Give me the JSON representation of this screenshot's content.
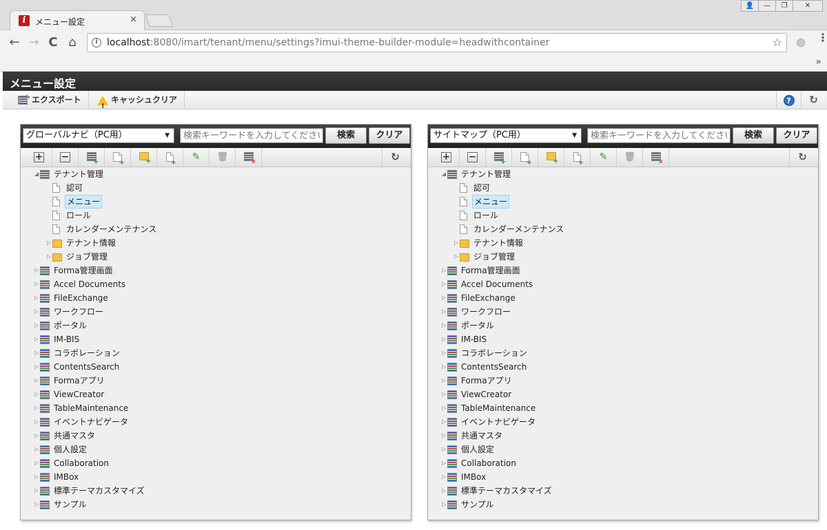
{
  "browser": {
    "tab_title": "メニュー設定",
    "favicon_letter": "i",
    "tab_close": "×",
    "url_host": "localhost",
    "url_rest": ":8080/imart/tenant/menu/settings?imui-theme-builder-module=headwithcontainer",
    "back": "←",
    "forward": "→",
    "reload": "C",
    "home": "⌂",
    "star": "☆",
    "win_user": "👤",
    "win_min": "—",
    "win_max": "❐",
    "win_close": "✕",
    "bookmarks_more": "»",
    "menu_dots": "⋮"
  },
  "page": {
    "title": "メニュー設定",
    "toolbar": {
      "export_label": "エクスポート",
      "cache_clear_label": "キャッシュクリア",
      "help_glyph": "?",
      "refresh_glyph": "↻"
    }
  },
  "panels": [
    {
      "select_value": "グローバルナビ（PC用）",
      "search_placeholder": "検索キーワードを入力してください。",
      "search_label": "検索",
      "clear_label": "クリア",
      "tree": [
        {
          "label": "テナント管理",
          "type": "menu",
          "level": 0,
          "toggle": "◢"
        },
        {
          "label": "認可",
          "type": "page",
          "level": 1,
          "toggle": ""
        },
        {
          "label": "メニュー",
          "type": "page",
          "level": 1,
          "toggle": "",
          "selected": true
        },
        {
          "label": "ロール",
          "type": "page",
          "level": 1,
          "toggle": ""
        },
        {
          "label": "カレンダーメンテナンス",
          "type": "page",
          "level": 1,
          "toggle": ""
        },
        {
          "label": "テナント情報",
          "type": "folder",
          "level": 1,
          "toggle": "▷"
        },
        {
          "label": "ジョブ管理",
          "type": "folder",
          "level": 1,
          "toggle": "▷"
        },
        {
          "label": "Forma管理画面",
          "type": "menu",
          "level": 0,
          "toggle": "▷"
        },
        {
          "label": "Accel Documents",
          "type": "menu",
          "level": 0,
          "toggle": "▷"
        },
        {
          "label": "FileExchange",
          "type": "menu",
          "level": 0,
          "toggle": "▷"
        },
        {
          "label": "ワークフロー",
          "type": "menu",
          "level": 0,
          "toggle": "▷"
        },
        {
          "label": "ポータル",
          "type": "menu",
          "level": 0,
          "toggle": "▷"
        },
        {
          "label": "IM-BIS",
          "type": "menu",
          "level": 0,
          "toggle": "▷"
        },
        {
          "label": "コラボレーション",
          "type": "menu",
          "level": 0,
          "toggle": "▷"
        },
        {
          "label": "ContentsSearch",
          "type": "menu",
          "level": 0,
          "toggle": "▷"
        },
        {
          "label": "Formaアプリ",
          "type": "menu",
          "level": 0,
          "toggle": "▷"
        },
        {
          "label": "ViewCreator",
          "type": "menu",
          "level": 0,
          "toggle": "▷"
        },
        {
          "label": "TableMaintenance",
          "type": "menu",
          "level": 0,
          "toggle": "▷"
        },
        {
          "label": "イベントナビゲータ",
          "type": "menu",
          "level": 0,
          "toggle": "▷"
        },
        {
          "label": "共通マスタ",
          "type": "menu",
          "level": 0,
          "toggle": "▷"
        },
        {
          "label": "個人設定",
          "type": "menu",
          "level": 0,
          "toggle": "▷"
        },
        {
          "label": "Collaboration",
          "type": "menu",
          "level": 0,
          "toggle": "▷"
        },
        {
          "label": "IMBox",
          "type": "menu",
          "level": 0,
          "toggle": "▷"
        },
        {
          "label": "標準テーマカスタマイズ",
          "type": "menu",
          "level": 0,
          "toggle": "▷"
        },
        {
          "label": "サンプル",
          "type": "menu",
          "level": 0,
          "toggle": "▷"
        }
      ]
    },
    {
      "select_value": "サイトマップ（PC用）",
      "search_placeholder": "検索キーワードを入力してください。",
      "search_label": "検索",
      "clear_label": "クリア",
      "tree": [
        {
          "label": "テナント管理",
          "type": "menu",
          "level": 0,
          "toggle": "◢"
        },
        {
          "label": "認可",
          "type": "page",
          "level": 1,
          "toggle": ""
        },
        {
          "label": "メニュー",
          "type": "page",
          "level": 1,
          "toggle": "",
          "selected": true
        },
        {
          "label": "ロール",
          "type": "page",
          "level": 1,
          "toggle": ""
        },
        {
          "label": "カレンダーメンテナンス",
          "type": "page",
          "level": 1,
          "toggle": ""
        },
        {
          "label": "テナント情報",
          "type": "folder",
          "level": 1,
          "toggle": "▷"
        },
        {
          "label": "ジョブ管理",
          "type": "folder",
          "level": 1,
          "toggle": "▷"
        },
        {
          "label": "Forma管理画面",
          "type": "menu",
          "level": 0,
          "toggle": "▷"
        },
        {
          "label": "Accel Documents",
          "type": "menu",
          "level": 0,
          "toggle": "▷"
        },
        {
          "label": "FileExchange",
          "type": "menu",
          "level": 0,
          "toggle": "▷"
        },
        {
          "label": "ワークフロー",
          "type": "menu",
          "level": 0,
          "toggle": "▷"
        },
        {
          "label": "ポータル",
          "type": "menu",
          "level": 0,
          "toggle": "▷"
        },
        {
          "label": "IM-BIS",
          "type": "menu",
          "level": 0,
          "toggle": "▷"
        },
        {
          "label": "コラボレーション",
          "type": "menu",
          "level": 0,
          "toggle": "▷"
        },
        {
          "label": "ContentsSearch",
          "type": "menu",
          "level": 0,
          "toggle": "▷"
        },
        {
          "label": "Formaアプリ",
          "type": "menu",
          "level": 0,
          "toggle": "▷"
        },
        {
          "label": "ViewCreator",
          "type": "menu",
          "level": 0,
          "toggle": "▷"
        },
        {
          "label": "TableMaintenance",
          "type": "menu",
          "level": 0,
          "toggle": "▷"
        },
        {
          "label": "イベントナビゲータ",
          "type": "menu",
          "level": 0,
          "toggle": "▷"
        },
        {
          "label": "共通マスタ",
          "type": "menu",
          "level": 0,
          "toggle": "▷"
        },
        {
          "label": "個人設定",
          "type": "menu",
          "level": 0,
          "toggle": "▷"
        },
        {
          "label": "Collaboration",
          "type": "menu",
          "level": 0,
          "toggle": "▷"
        },
        {
          "label": "IMBox",
          "type": "menu",
          "level": 0,
          "toggle": "▷"
        },
        {
          "label": "標準テーマカスタマイズ",
          "type": "menu",
          "level": 0,
          "toggle": "▷"
        },
        {
          "label": "サンプル",
          "type": "menu",
          "level": 0,
          "toggle": "▷"
        }
      ]
    }
  ],
  "tree_toolbar_icons": [
    "plus-icon",
    "minus-icon",
    "add-menu-icon",
    "add-page-icon",
    "add-folder-icon",
    "add-file-icon",
    "pencil-icon",
    "trash-icon",
    "delete-menu-icon",
    "refresh-icon"
  ],
  "tree_toolbar_glyphs": {
    "plus": "+",
    "minus": "−",
    "pencil": "✎",
    "trash": "🗑",
    "refresh": "↻",
    "add": "+",
    "del": "✕"
  },
  "colors": {
    "header_bg": "#2a2a2a",
    "selection": "#cdeaf9",
    "help_blue": "#2f6fc6"
  }
}
